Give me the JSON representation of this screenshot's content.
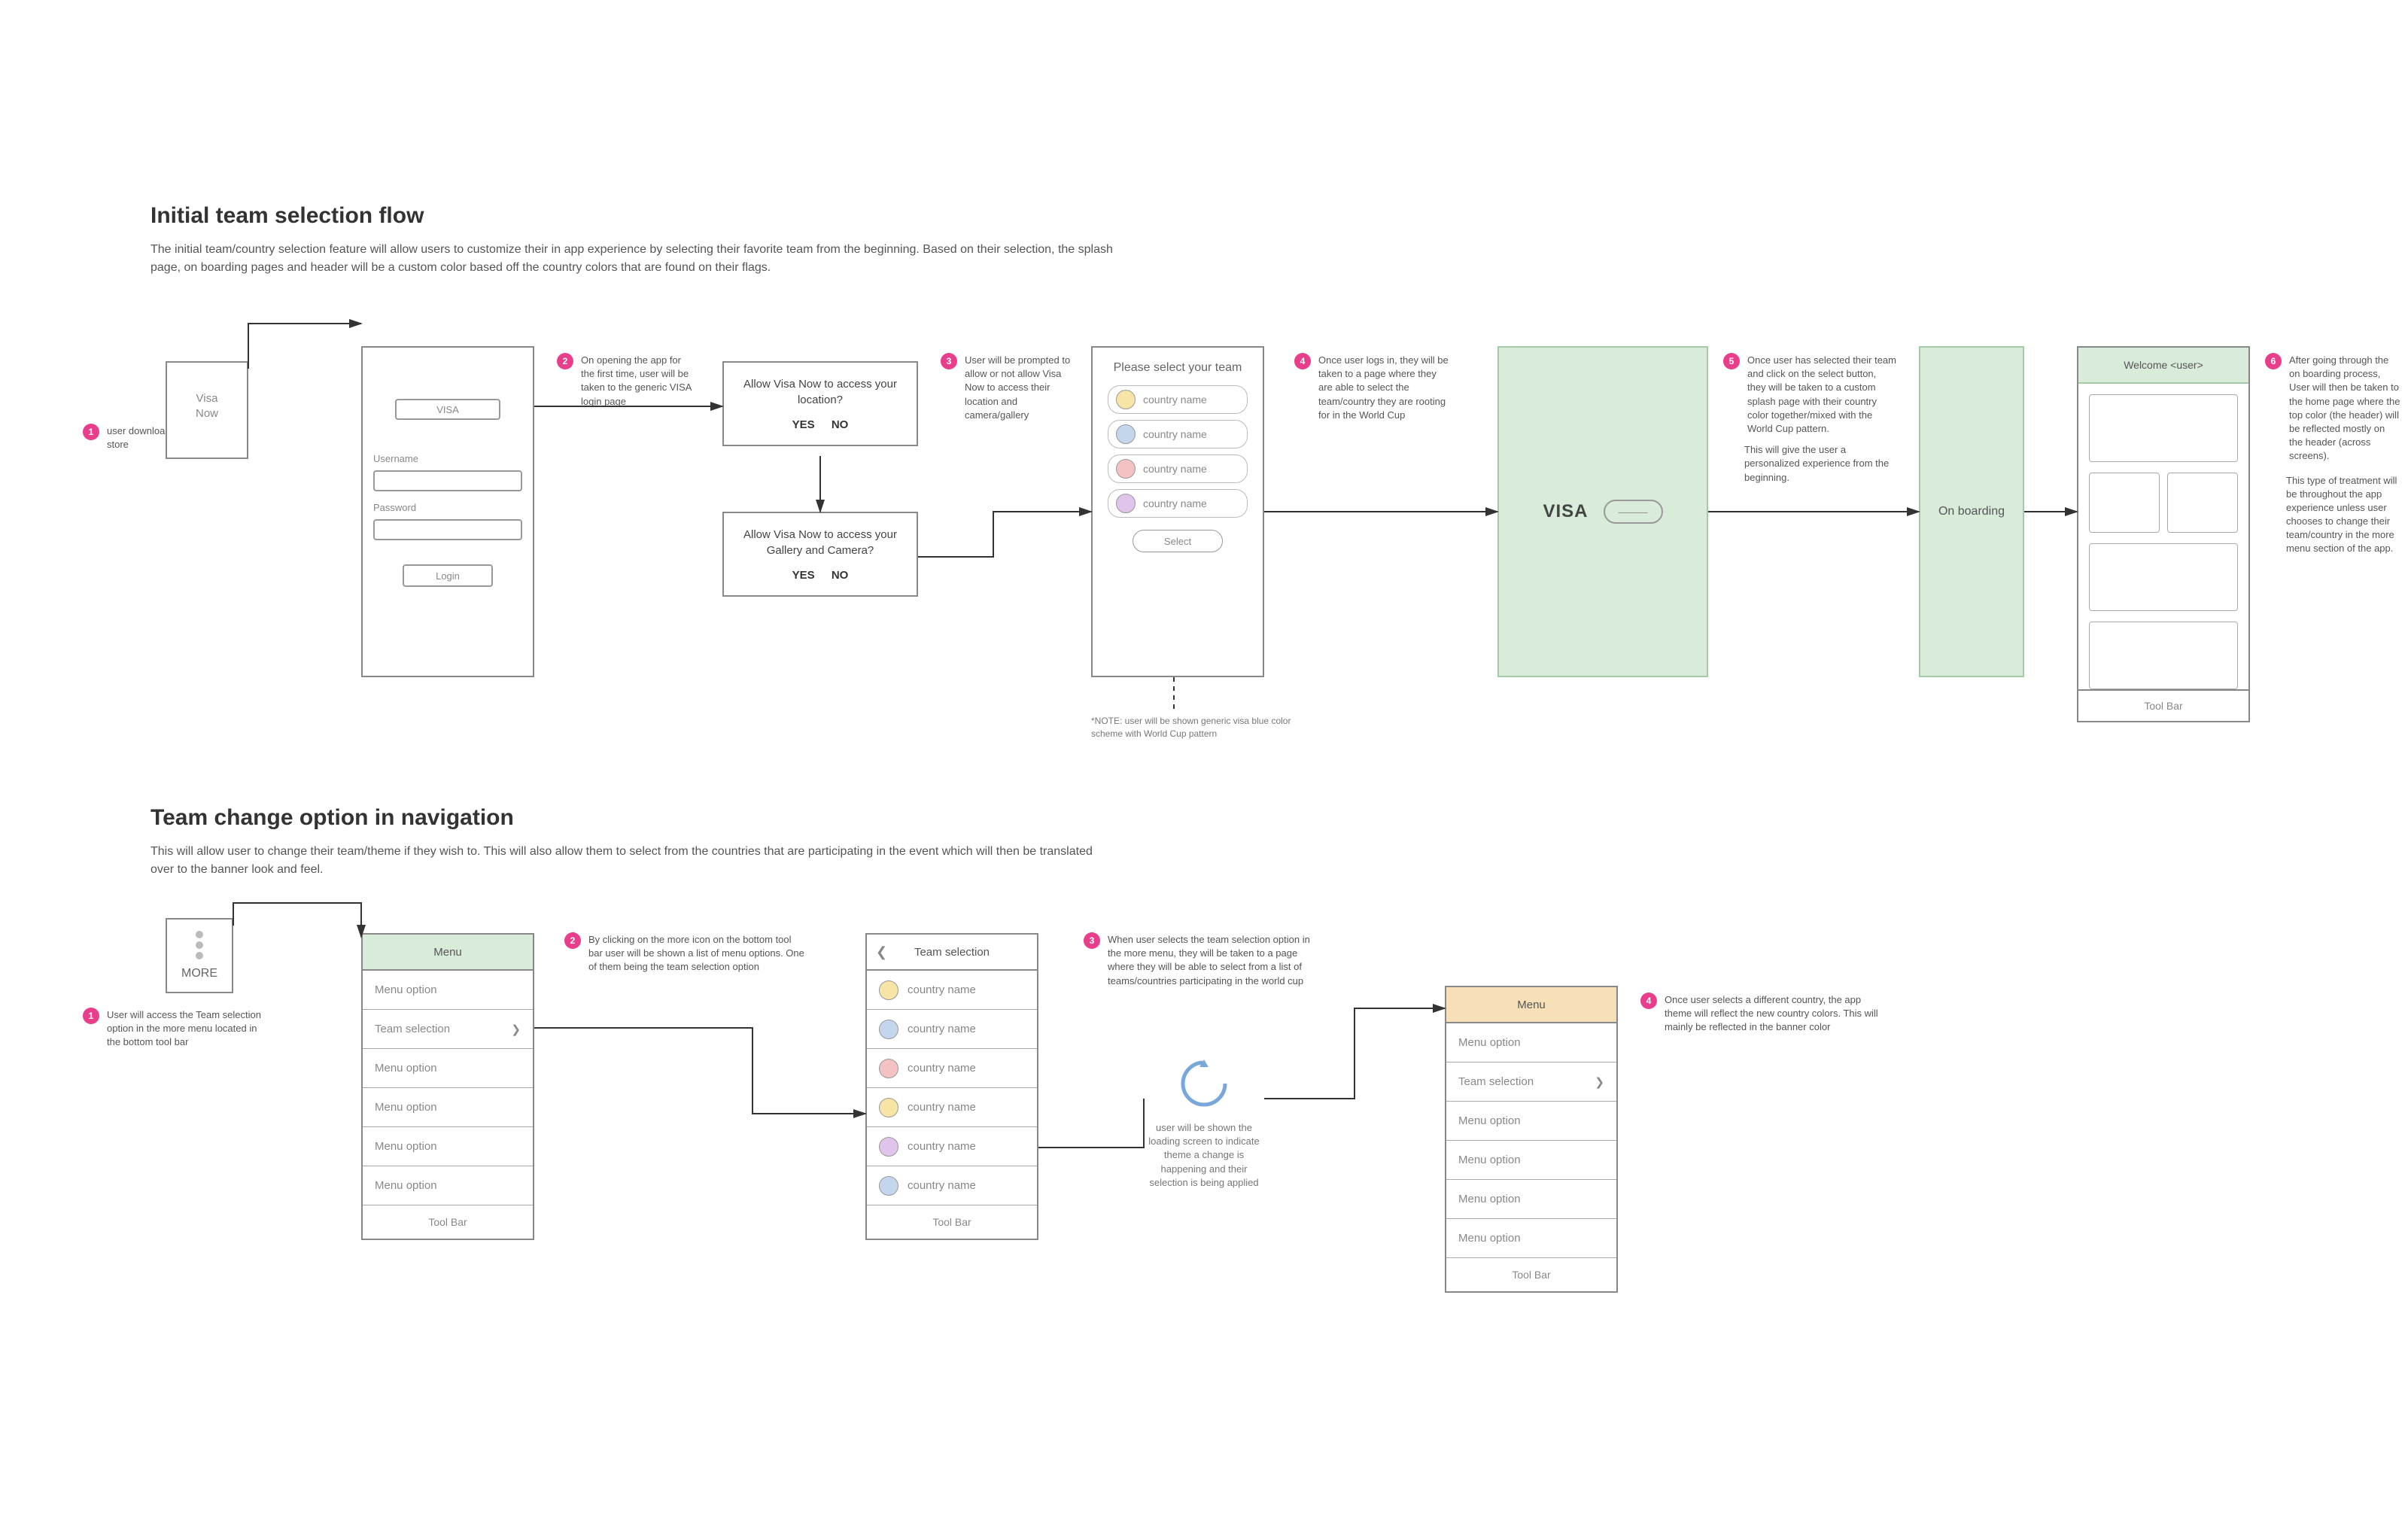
{
  "section1": {
    "title": "Initial team selection flow",
    "description": "The initial team/country selection feature will allow users to customize their in app experience by selecting their favorite team from the beginning. Based on their selection, the splash page, on boarding pages and header will be a custom color based off the country colors that are found on their flags."
  },
  "appstore": {
    "line1": "Visa",
    "line2": "Now"
  },
  "login": {
    "brand": "VISA",
    "username_label": "Username",
    "password_label": "Password",
    "login_btn": "Login"
  },
  "dialog_location": {
    "text": "Allow Visa Now to access your location?",
    "yes": "YES",
    "no": "NO"
  },
  "dialog_gallery": {
    "text": "Allow Visa Now to access your Gallery and Camera?",
    "yes": "YES",
    "no": "NO"
  },
  "team_select": {
    "title": "Please select your team",
    "row1": "country name",
    "row2": "country name",
    "row3": "country name",
    "row4": "country name",
    "select_btn": "Select",
    "note": "*NOTE: user will be shown generic visa blue color scheme with World Cup pattern"
  },
  "visa_splash": {
    "brand": "VISA",
    "pill": "———"
  },
  "onboarding": {
    "label": "On boarding"
  },
  "home": {
    "header": "Welcome <user>",
    "footer": "Tool Bar"
  },
  "annot": {
    "a1": "user downloads app from app store",
    "a2": "On opening the app for the first time, user will be taken to the generic VISA login page",
    "a3": "User will be prompted to allow or not allow Visa Now to access their location and camera/gallery",
    "a4": "Once user logs in, they will be taken to a page where they are able to select the team/country they are rooting for in the World Cup",
    "a5": "Once user has selected their team and click on the select button, they will be taken to a custom splash page with their country color together/mixed with the World Cup pattern.",
    "a5b": "This will give the user a personalized experience from the beginning.",
    "a6a": "After going through the on boarding process, User will then be taken to the home page where the top color (the header) will be reflected mostly on the header (across screens).",
    "a6b": "This type of treatment will be throughout the app experience unless user chooses to change their team/country in the more menu section of the app."
  },
  "section2": {
    "title": "Team change option in navigation",
    "description": "This will allow user to change their team/theme if they wish to. This will also allow them to select from the countries that are participating in the event which will then be translated over to the banner look and feel."
  },
  "more": {
    "label": "MORE"
  },
  "menu_green": {
    "header": "Menu",
    "item_generic": "Menu option",
    "item_team": "Team selection",
    "footer": "Tool Bar"
  },
  "team_select2": {
    "header": "Team selection",
    "row": "country name",
    "footer": "Tool Bar"
  },
  "loading": {
    "text": "user will be shown the loading screen to indicate theme a change is happening and their selection is being applied"
  },
  "menu_orange": {
    "header": "Menu",
    "item_generic": "Menu option",
    "item_team": "Team selection",
    "footer": "Tool Bar"
  },
  "annot2": {
    "b1": "User will access the Team selection option in the more menu located in the bottom tool bar",
    "b2": "By clicking on the more icon on the bottom tool bar user will be shown a list of menu options. One of them being the team selection option",
    "b3": "When user selects the team selection option in the more menu, they will be taken to a page where they will be able to select from a list of teams/countries participating in the world cup",
    "b4": "Once user selects a different country, the app theme will reflect the new country colors. This will mainly be reflected in the banner color"
  }
}
